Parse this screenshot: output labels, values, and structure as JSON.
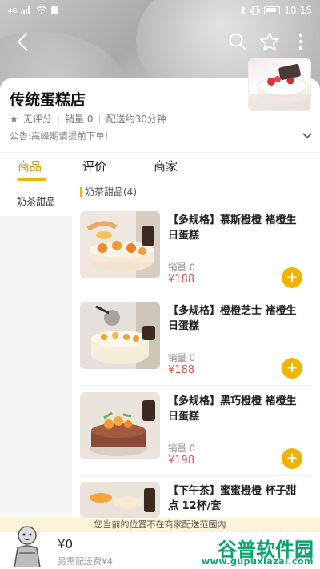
{
  "status_bar": {
    "left_text": "4G",
    "time": "10:15"
  },
  "shop": {
    "name": "传统蛋糕店",
    "rating": "无评分",
    "sales": "销量 0",
    "delivery": "配送约30分钟",
    "notice": "公告:高峰期请提前下单!"
  },
  "tabs": [
    {
      "label": "商品"
    },
    {
      "label": "评价"
    },
    {
      "label": "商家"
    }
  ],
  "categories": [
    {
      "label": "奶茶甜品"
    }
  ],
  "section": {
    "title": "奶茶甜品(4)"
  },
  "products": [
    {
      "name": "【多规格】慕斯橙橙 褚橙生日蛋糕",
      "sales": "销量 0",
      "price": "¥188",
      "add": "+"
    },
    {
      "name": "【多规格】橙橙芝士 褚橙生日蛋糕",
      "sales": "销量 0",
      "price": "¥188",
      "add": "+"
    },
    {
      "name": "【多规格】黑巧橙橙 褚橙生日蛋糕",
      "sales": "销量 0",
      "price": "¥198",
      "add": "+"
    },
    {
      "name": "【下午茶】蜜蜜橙橙 杯子甜点 12杯/套",
      "sales": "",
      "price": "",
      "add": ""
    }
  ],
  "bottom": {
    "range_tip": "您当前的位置不在商家配送范围内",
    "total": "¥0",
    "delivery_fee": "另需配送费¥4"
  },
  "watermark": {
    "brand": "谷普软件园",
    "url": "www.gupuxlazal.com"
  },
  "colors": {
    "accent": "#f0b400",
    "price": "#e3504b",
    "tab_active": "#c8940a"
  }
}
